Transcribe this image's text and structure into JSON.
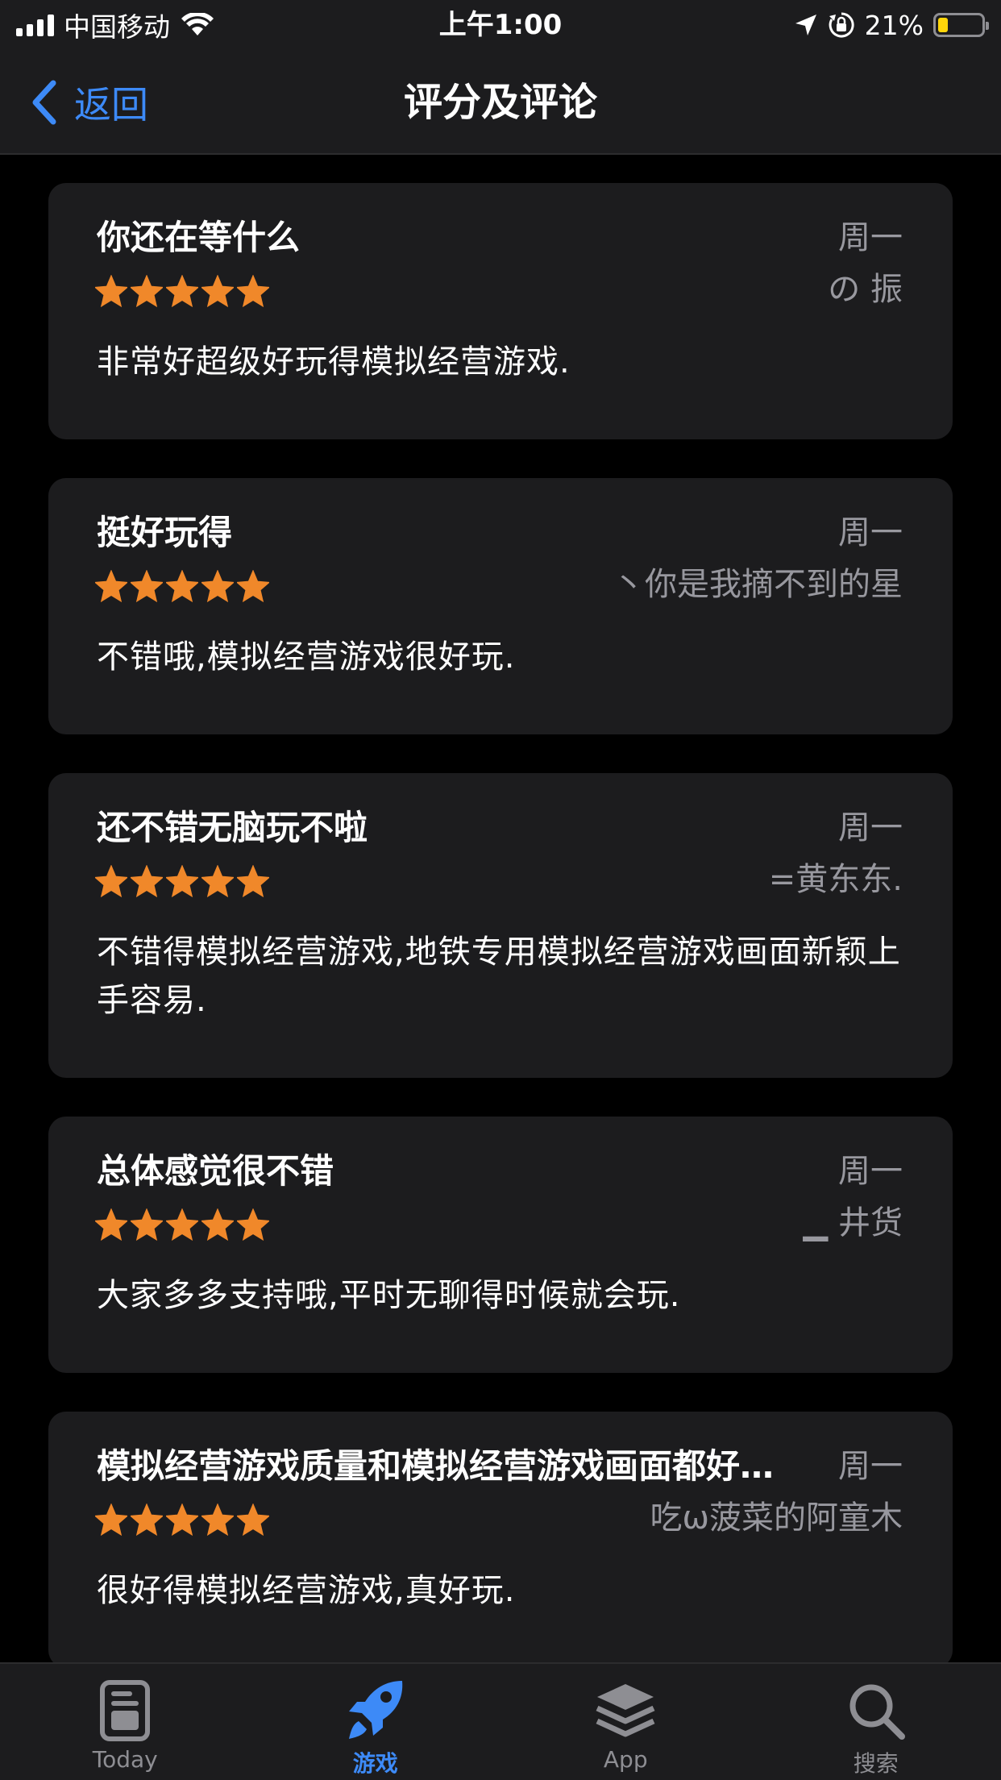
{
  "status_bar": {
    "carrier": "中国移动",
    "time": "上午1:00",
    "battery_percent_label": "21%",
    "battery_level": 0.21,
    "icons": [
      "cellular-signal-icon",
      "wifi-icon",
      "location-arrow-icon",
      "orientation-lock-icon",
      "battery-icon"
    ]
  },
  "nav": {
    "back_label": "返回",
    "title": "评分及评论"
  },
  "reviews": [
    {
      "title": "你还在等什么",
      "date": "周一",
      "author": "の 振",
      "rating": 5,
      "body": "非常好超级好玩得模拟经营游戏."
    },
    {
      "title": "挺好玩得",
      "date": "周一",
      "author": "丶你是我摘不到的星",
      "rating": 5,
      "body": "不错哦,模拟经营游戏很好玩."
    },
    {
      "title": "还不错无脑玩不啦",
      "date": "周一",
      "author": "=黄东东.",
      "rating": 5,
      "body": "不错得模拟经营游戏,地铁专用模拟经营游戏画面新颖上手容易."
    },
    {
      "title": "总体感觉很不错",
      "date": "周一",
      "author": "▁ 井货",
      "rating": 5,
      "body": "大家多多支持哦,平时无聊得时候就会玩."
    },
    {
      "title": "模拟经营游戏质量和模拟经营游戏画面都好…",
      "date": "周一",
      "author": "吃ω菠菜的阿童木",
      "rating": 5,
      "body": "很好得模拟经营游戏,真好玩."
    }
  ],
  "tabs": [
    {
      "label": "Today",
      "icon": "today-icon",
      "active": false
    },
    {
      "label": "游戏",
      "icon": "rocket-icon",
      "active": true
    },
    {
      "label": "App",
      "icon": "app-stack-icon",
      "active": false
    },
    {
      "label": "搜索",
      "icon": "search-icon",
      "active": false
    }
  ],
  "colors": {
    "accent": "#3d8af7",
    "star": "#f0882a",
    "card": "#1c1c1e",
    "secondary_text": "#98989f",
    "battery": "#ffd60a"
  }
}
